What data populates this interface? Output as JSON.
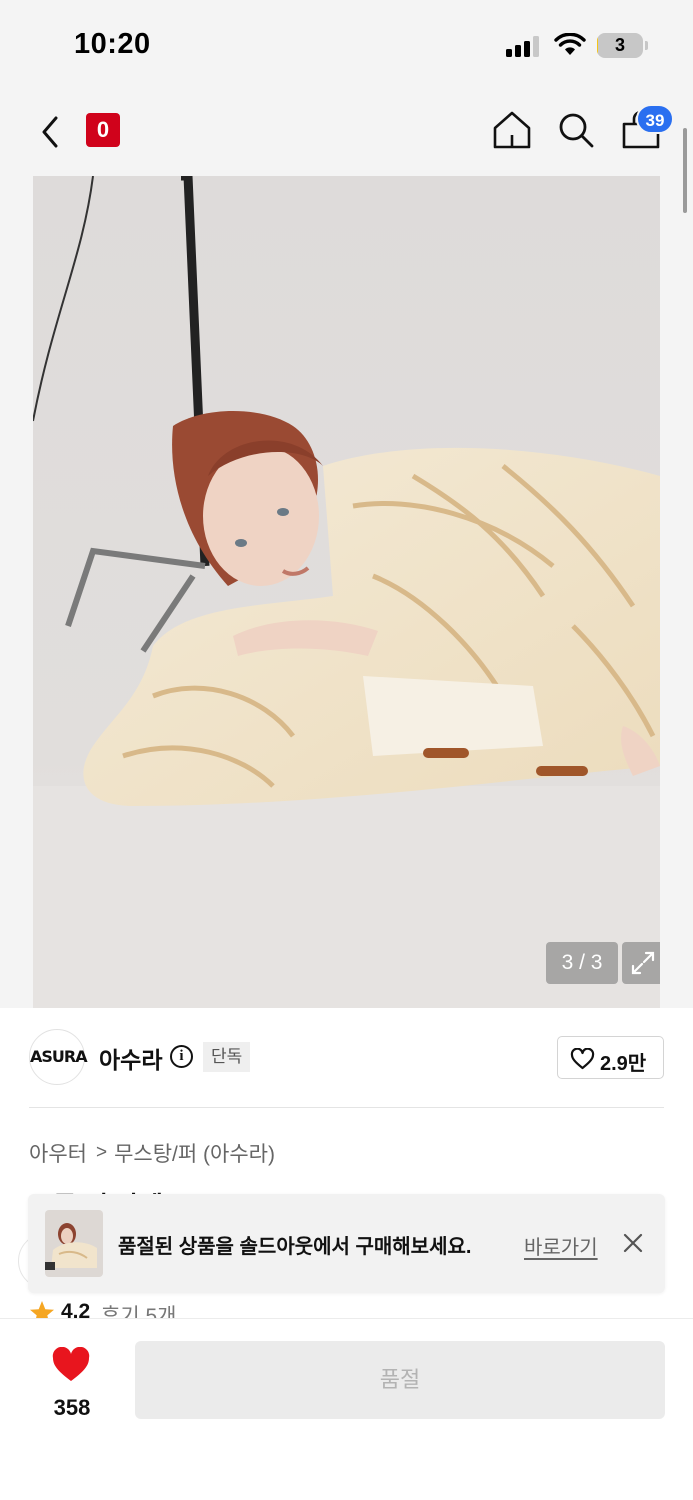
{
  "status_bar": {
    "time": "10:20",
    "battery_level": "3",
    "battery_fraction": 0.03,
    "signal_bars": 3,
    "wifi": true
  },
  "header": {
    "brand_logo_text": "0",
    "brand_logo_color": "#d0021b",
    "icons": [
      "chevron-left-icon",
      "home-icon",
      "search-icon",
      "shopping-bag-icon"
    ],
    "cart_badge": "39",
    "cart_badge_color": "#2a6ff0"
  },
  "gallery": {
    "counter": "3 / 3",
    "expand_icon": "expand-icon"
  },
  "brand": {
    "logo_text": "ASURA",
    "name": "아수라",
    "info_icon_text": "i",
    "badge": "단독",
    "like_count": "2.9만"
  },
  "product": {
    "breadcrumb": [
      "아우터",
      "무스탕/퍼 (아수라)"
    ],
    "breadcrumb_separator": ">",
    "title": "토글 퍼 자켓 (WOMAN)",
    "rating": "4.2",
    "reviews": "후기 5개",
    "rating_color": "#f5a623"
  },
  "toast": {
    "message": "품절된 상품을 솔드아웃에서 구매해보세요.",
    "link": "바로가기",
    "close_icon": "close-icon"
  },
  "bottom_bar": {
    "wish_count": "358",
    "wish_color": "#e8151e",
    "cta_label": "품절"
  }
}
